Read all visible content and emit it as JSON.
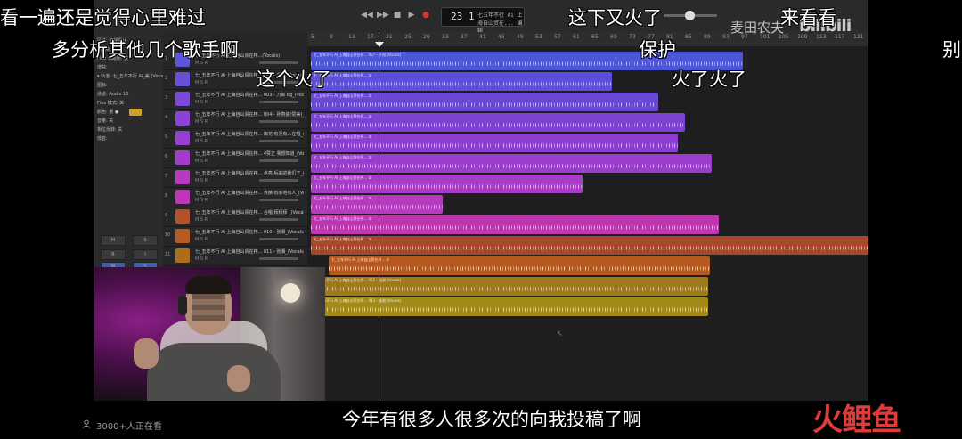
{
  "daw": {
    "project_title": "七五年不行 Ai 上海自山贸在... 编辑",
    "lcd_position": "23 1",
    "ruler_ticks": [
      "5",
      "9",
      "13",
      "17",
      "21",
      "25",
      "29",
      "33",
      "37",
      "41",
      "45",
      "49",
      "53",
      "57",
      "61",
      "65",
      "69",
      "73",
      "77",
      "81",
      "85",
      "89",
      "93",
      "97",
      "101",
      "105",
      "109",
      "113",
      "117",
      "121"
    ],
    "inspector_rows": [
      "区域: 音频默认",
      "▸ 区块",
      "   Flex 和跟随: 关",
      "   增益:",
      "▾ 轨道: 七_五年不行 Ai_美 (Vocals)",
      "   图标:",
      "   通道: Audio 10",
      "   Flex 模式: 关",
      "   颜色: 量 ●",
      "   音量: 关",
      "   相位反转: 关",
      "   低音:"
    ],
    "inspector_buttons": [
      "M",
      "S",
      "R",
      "I",
      "M",
      "S"
    ],
    "tracks": [
      {
        "num": "1",
        "name": "七_五年不行 Ai 上海自山贸在杯...(Vocals)",
        "ms": "M S R",
        "color": "#5b56d6"
      },
      {
        "num": "2",
        "name": "七_五年不行 Ai 上海自山贸在杯... 007 - 千阳 (Vocals)",
        "ms": "M S R",
        "color": "#6a4fd8"
      },
      {
        "num": "3",
        "name": "七_五年不行 Ai 上海自山贸在杯... 003 - 刀郎 bg_(Vocals)",
        "ms": "M S R",
        "color": "#7b48d8"
      },
      {
        "num": "4",
        "name": "七_五年不行 Ai 上海自山贸在杯... 004 - 孙燕姿(赞美)_(Vocals)",
        "ms": "M S R",
        "color": "#8a43d6"
      },
      {
        "num": "5",
        "name": "七_五年不行 Ai 上海自山贸在杯... 梅花 有没有人在唱_(Vocals)",
        "ms": "M S R",
        "color": "#9440d0"
      },
      {
        "num": "6",
        "name": "七_五年不行 Ai 上海自山贸在杯... 4赞正 我想知道_(Vocals)",
        "ms": "M S R",
        "color": "#a43ccb"
      },
      {
        "num": "7",
        "name": "七_五年不行 Ai 上海自山贸在杯... 点亮 后来的我们了_(Vocals)",
        "ms": "M S R",
        "color": "#b53bc0"
      },
      {
        "num": "8",
        "name": "七_五年不行 Ai 上海自山贸在杯... 点精 有余地有人_(Vocals)",
        "ms": "M S R",
        "color": "#c037b6"
      },
      {
        "num": "9",
        "name": "七_五年不行 Ai 上海自山贸在杯... 合唱 拜拜拜 _(Vocals)",
        "ms": "M S R",
        "color": "#b3512a"
      },
      {
        "num": "10",
        "name": "七_五年不行 Ai 上海自山贸在杯... 010 - 张湘_(Vocals)",
        "ms": "M S R",
        "color": "#b85a22"
      },
      {
        "num": "11",
        "name": "七_五年不行 Ai 上海自山贸在杯... 011 - 张湘_(Vocals)",
        "ms": "M S R",
        "color": "#ad6d1f"
      }
    ],
    "regions": [
      {
        "label": "七_五年不行 Ai 上海自山贸在杯... 007 - 千阳 (Vocals)",
        "color": "#4d55d9"
      },
      {
        "label": "七_五年不行 Ai 上海自山贸在杯... ②",
        "color": "#5c4fd9"
      },
      {
        "label": "七_五年不行 Ai 上海自山贸在杯... ②",
        "color": "#6b47d6"
      },
      {
        "label": "七_五年不行 Ai 上海自山贸在杯... ②",
        "color": "#7b42d3"
      },
      {
        "label": "七_五年不行 Ai 上海自山贸在杯... ②",
        "color": "#8a3fd2"
      },
      {
        "label": "七_五年不行 Ai 上海自山贸在杯... ②",
        "color": "#9a3dcc"
      },
      {
        "label": "七_五年不行 Ai 上海自山贸在杯... ②",
        "color": "#a93cc6"
      },
      {
        "label": "七_五年不行 Ai 上海自山贸在杯... ②",
        "color": "#b73bbe"
      },
      {
        "label": "七_五年不行 Ai 上海自山贸在杯... ②",
        "color": "#bd36b0"
      },
      {
        "label": "七_五年不行 Ai 上海自山贸在杯... ②",
        "color": "#a5492a"
      },
      {
        "label": "七_五年不行 Ai 上海自山贸在杯... ②",
        "color": "#b5591e"
      },
      {
        "label": "七_五年不行 Ai 上海自山贸在杯... 011 - 张湘 (Vocals)",
        "color": "#9e7a1c"
      },
      {
        "label": "七_五年不行 Ai 上海自山贸在杯... 012 - 张湘 (Vocals)",
        "color": "#a38a18"
      }
    ]
  },
  "danmaku": [
    "看一遍还是觉得心里难过",
    "这下又火了",
    "来看看",
    "多分析其他几个歌手啊",
    "保护",
    "别",
    "这个火了",
    "火了火了"
  ],
  "watermark": "麦田农夫",
  "bili_logo": "bilibili",
  "viewers": "3000+人正在看",
  "subtitle": "今年有很多人很多次的向我投稿了啊",
  "brand": {
    "part1": "火",
    "part2": "鲤鱼"
  }
}
